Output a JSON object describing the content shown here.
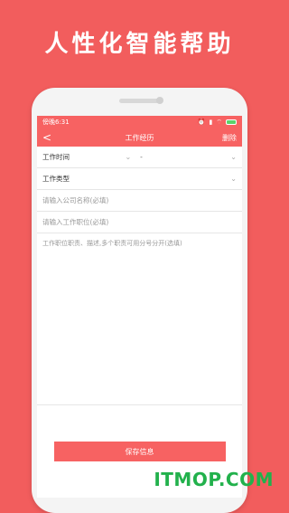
{
  "headline": "人性化智能帮助",
  "status": {
    "carrier_time": "傍晚6:31",
    "icons": [
      "alarm-icon",
      "signal-icon",
      "wifi-icon",
      "battery-icon"
    ]
  },
  "nav": {
    "back": "<",
    "title": "工作经历",
    "delete": "删除"
  },
  "form": {
    "work_time_label": "工作时间",
    "work_time_separator": "-",
    "work_type_label": "工作类型",
    "company_placeholder": "请输入公司名称(必填)",
    "position_placeholder": "请输入工作职位(必填)",
    "desc_placeholder": "工作职位职责、描述,多个职责可用分号分开(选填)",
    "save_button": "保存信息"
  },
  "watermark": "ITMOP.COM",
  "colors": {
    "background": "#f25d5d",
    "accent": "#f76262",
    "watermark": "#22b14c"
  }
}
